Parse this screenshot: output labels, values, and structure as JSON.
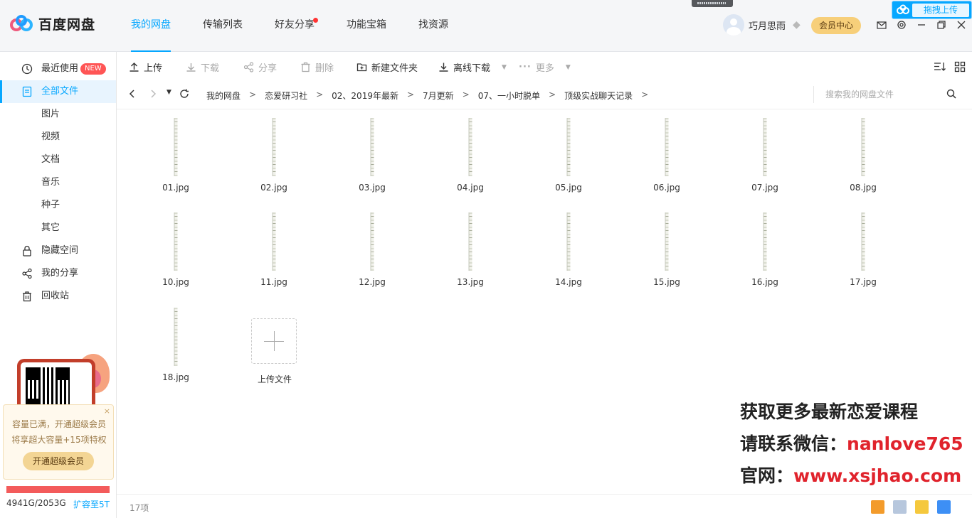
{
  "app": {
    "logo_text": "百度网盘",
    "brand_color": "#06a7ff"
  },
  "topnav": {
    "items": [
      {
        "label": "我的网盘",
        "active": true
      },
      {
        "label": "传输列表"
      },
      {
        "label": "好友分享",
        "dot": true
      },
      {
        "label": "功能宝箱"
      },
      {
        "label": "找资源"
      }
    ]
  },
  "user": {
    "name": "巧月思雨",
    "vip_button": "会员中心"
  },
  "upload_float": {
    "label": "拖拽上传"
  },
  "sidebar": {
    "items": [
      {
        "label": "最近使用",
        "badge": "NEW",
        "icon": "clock-icon"
      },
      {
        "label": "全部文件",
        "active": true,
        "icon": "file-icon"
      },
      {
        "label": "图片"
      },
      {
        "label": "视频"
      },
      {
        "label": "文档"
      },
      {
        "label": "音乐"
      },
      {
        "label": "种子"
      },
      {
        "label": "其它"
      },
      {
        "label": "隐藏空间",
        "icon": "lock-icon"
      },
      {
        "label": "我的分享",
        "icon": "share-icon"
      },
      {
        "label": "回收站",
        "icon": "trash-icon"
      }
    ],
    "promo": {
      "close": "×",
      "line1": "容量已满，开通超级会员",
      "line2": "将享超大容量+15项特权",
      "button": "开通超级会员"
    },
    "capacity": {
      "text": "4941G/2053G",
      "link": "扩容至5T",
      "used_fraction": 1.0
    }
  },
  "toolbar": {
    "upload": "上传",
    "download": "下载",
    "share": "分享",
    "delete": "删除",
    "new_folder": "新建文件夹",
    "offline_download": "离线下载",
    "more": "更多"
  },
  "breadcrumb": {
    "items": [
      "我的网盘",
      "恋爱研习社",
      "02、2019年最新",
      "7月更新",
      "07、一小时脱单",
      "顶级实战聊天记录"
    ],
    "sep": ">"
  },
  "search": {
    "placeholder": "搜索我的网盘文件"
  },
  "files": [
    "01.jpg",
    "02.jpg",
    "03.jpg",
    "04.jpg",
    "05.jpg",
    "06.jpg",
    "07.jpg",
    "08.jpg",
    "10.jpg",
    "11.jpg",
    "12.jpg",
    "13.jpg",
    "14.jpg",
    "15.jpg",
    "16.jpg",
    "17.jpg",
    "18.jpg"
  ],
  "upload_tile_label": "上传文件",
  "watermark": {
    "line1": "获取更多最新恋爱课程",
    "line2_prefix": "请联系微信：",
    "line2_value": "nanlove765",
    "line3_prefix": "官网：",
    "line3_value": "www.xsjhao.com"
  },
  "status": {
    "count": "17项"
  }
}
